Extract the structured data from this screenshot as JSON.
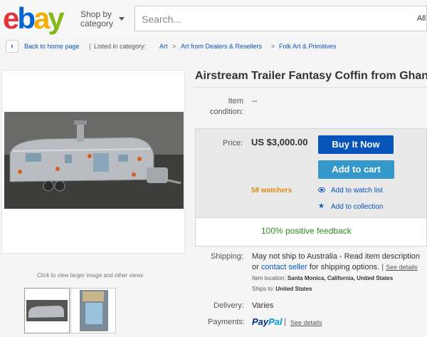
{
  "header": {
    "logo": {
      "e": "e",
      "b": "b",
      "a": "a",
      "y": "y"
    },
    "shop_by": "Shop by",
    "category": "category",
    "search_placeholder": "Search...",
    "category_select": "All"
  },
  "breadcrumb": {
    "back": "Back to home page",
    "pipe": "|",
    "listed_in": "Listed in category:",
    "items": [
      "Art",
      "Art from Dealers & Resellers",
      "Folk Art & Primitives"
    ],
    "separator": ">"
  },
  "gallery": {
    "caption": "Click to view larger image and other views"
  },
  "item": {
    "title": "Airstream Trailer Fantasy Coffin from Ghana",
    "condition_label_1": "Item",
    "condition_label_2": "condition:",
    "condition_value": "--",
    "price_label": "Price:",
    "price": "US $3,000.00",
    "buy_now": "Buy It Now",
    "add_to_cart": "Add to cart",
    "watchers": "58 watchers",
    "watch_list": "Add to watch list",
    "collection": "Add to collection",
    "feedback": "100% positive feedback"
  },
  "shipping": {
    "label": "Shipping:",
    "line1": "May not ship to Australia - Read item description",
    "or": "or ",
    "contact": "contact seller",
    "for_options": " for shipping options.",
    "sep": " | ",
    "see_details": "See details",
    "location_label": "Item location:",
    "location": "Santa Monica, California, United States",
    "ships_to_label": "Ships to:",
    "ships_to": "United States"
  },
  "delivery": {
    "label": "Delivery:",
    "value": "Varies"
  },
  "payments": {
    "label": "Payments:",
    "paypal_1": "Pay",
    "paypal_2": "Pal",
    "sep": "|",
    "see_details": "See details"
  },
  "colors": {
    "link": "#0654ba",
    "buy": "#0654ba",
    "cart": "#3498ca",
    "watchers": "#e08a10",
    "feedback": "#2d8c1c"
  }
}
